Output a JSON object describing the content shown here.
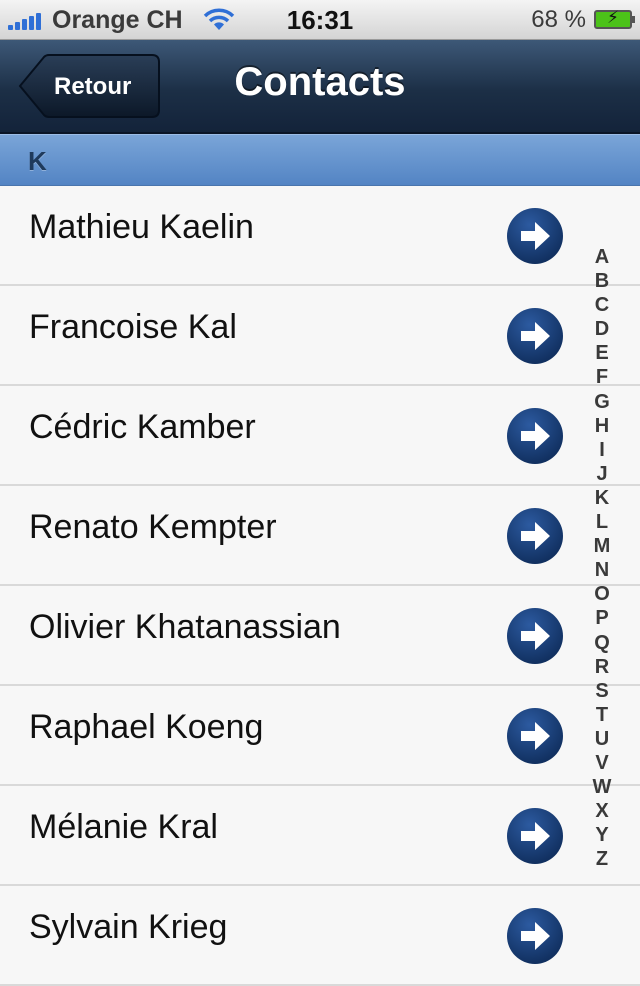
{
  "status_bar": {
    "carrier": "Orange CH",
    "time": "16:31",
    "battery": "68 %"
  },
  "nav": {
    "back_label": "Retour",
    "title": "Contacts"
  },
  "section": {
    "letter": "K"
  },
  "contacts": [
    "Mathieu Kaelin",
    "Francoise Kal",
    "Cédric Kamber",
    "Renato Kempter",
    "Olivier Khatanassian",
    "Raphael Koeng",
    "Mélanie Kral",
    "Sylvain Krieg"
  ],
  "index_letters": [
    "A",
    "B",
    "C",
    "D",
    "E",
    "F",
    "G",
    "H",
    "I",
    "J",
    "K",
    "L",
    "M",
    "N",
    "O",
    "P",
    "Q",
    "R",
    "S",
    "T",
    "U",
    "V",
    "W",
    "X",
    "Y",
    "Z"
  ],
  "icons": {
    "signal": "signal-bars-icon",
    "wifi": "wifi-icon",
    "battery": "battery-charging-icon",
    "disclosure": "arrow-right-circle-icon"
  },
  "colors": {
    "nav_bar": "#1c2f46",
    "section_header": "#6a96cf",
    "disclosure": "#1a3f78",
    "battery_fill": "#4cc219"
  }
}
